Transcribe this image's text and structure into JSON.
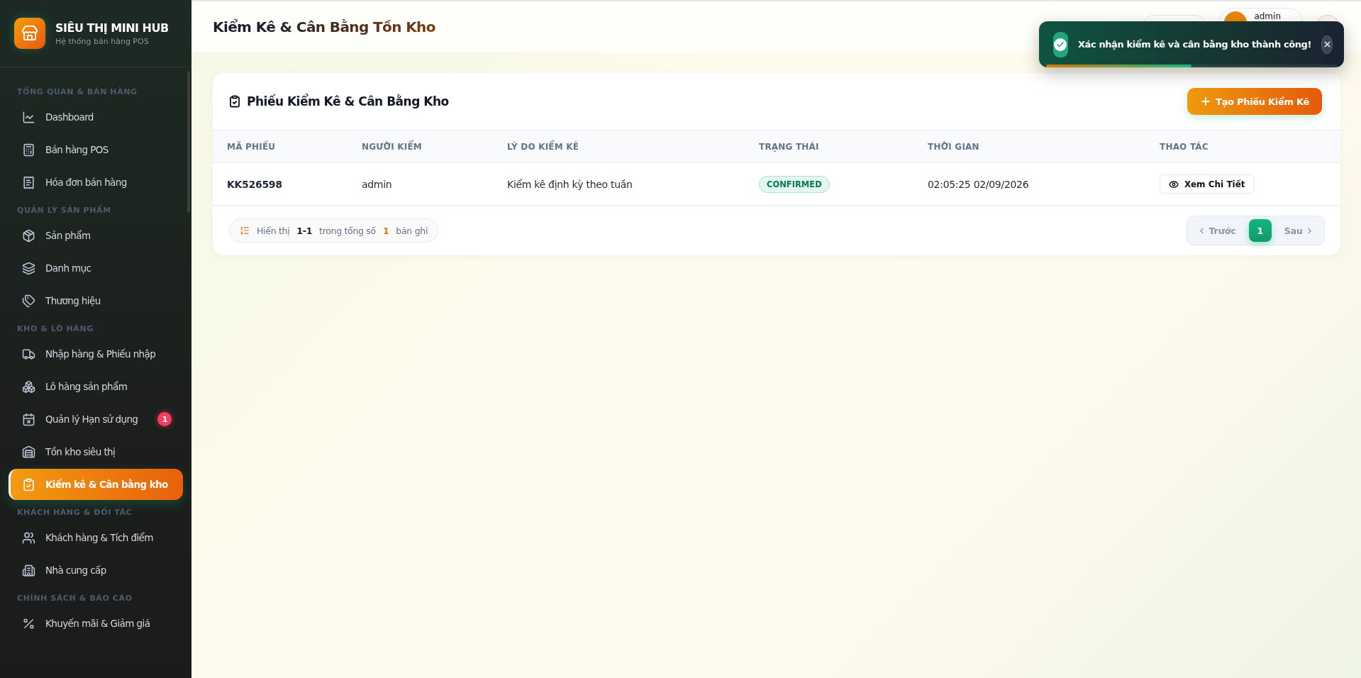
{
  "brand": {
    "name": "SIÊU THỊ MINI HUB",
    "subtitle": "Hệ thống bán hàng POS"
  },
  "sidebar": {
    "sections": [
      {
        "label": "TỔNG QUAN & BÁN HÀNG",
        "items": [
          {
            "label": "Dashboard",
            "selected": false
          },
          {
            "label": "Bán hàng POS",
            "selected": false
          },
          {
            "label": "Hóa đơn bán hàng",
            "selected": false
          }
        ]
      },
      {
        "label": "QUẢN LÝ SẢN PHẨM",
        "items": [
          {
            "label": "Sản phẩm",
            "selected": false
          },
          {
            "label": "Danh mục",
            "selected": false
          },
          {
            "label": "Thương hiệu",
            "selected": false
          }
        ]
      },
      {
        "label": "KHO & LÔ HÀNG",
        "items": [
          {
            "label": "Nhập hàng & Phiếu nhập",
            "selected": false
          },
          {
            "label": "Lô hàng sản phẩm",
            "selected": false
          },
          {
            "label": "Quản lý Hạn sử dụng",
            "selected": false,
            "badge": "1"
          },
          {
            "label": "Tồn kho siêu thị",
            "selected": false
          },
          {
            "label": "Kiểm kê & Cân bằng kho",
            "selected": true
          }
        ]
      },
      {
        "label": "KHÁCH HÀNG & ĐỐI TÁC",
        "items": [
          {
            "label": "Khách hàng & Tích điểm",
            "selected": false
          },
          {
            "label": "Nhà cung cấp",
            "selected": false
          }
        ]
      },
      {
        "label": "CHÍNH SÁCH & BÁO CÁO",
        "items": [
          {
            "label": "Khuyến mãi & Giảm giá",
            "selected": false
          }
        ]
      }
    ]
  },
  "header": {
    "title": "Kiểm Kê & Cân Bằng Tồn Kho",
    "user_name": "admin"
  },
  "toast": {
    "message": "Xác nhận kiểm kê và cân bằng kho thành công!",
    "level": 0.5
  },
  "card": {
    "title": "Phiếu Kiểm Kê & Cân Bằng Kho",
    "create_button": "Tạo Phiếu Kiểm Kê",
    "columns": [
      "MÃ PHIẾU",
      "NGƯỜI KIỂM",
      "LÝ DO KIỂM KÊ",
      "TRẠNG THÁI",
      "THỜI GIAN",
      "THAO TÁC"
    ],
    "rows": [
      {
        "code": "KK526598",
        "checker": "admin",
        "reason": "Kiểm kê định kỳ theo tuần",
        "status": "CONFIRMED",
        "time": "02:05:25 02/09/2026",
        "action": "Xem Chi Tiết"
      }
    ],
    "summary": {
      "prefix": "Hiển thị",
      "range": "1-1",
      "middle": "trong tổng số",
      "total": "1",
      "suffix": "bản ghi"
    },
    "pagination": {
      "prev": "Trước",
      "pages": [
        {
          "label": "1",
          "selected": true
        }
      ],
      "next": "Sau"
    }
  }
}
